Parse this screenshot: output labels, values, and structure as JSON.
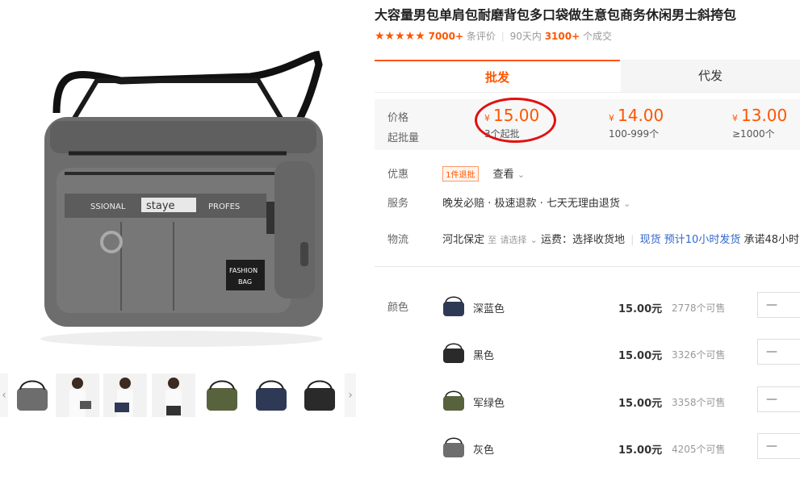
{
  "product": {
    "title": "大容量男包单肩包耐磨背包多口袋做生意包商务休闲男士斜挎包",
    "stars": "★★★★★",
    "review_count": "7000+",
    "review_label": "条评价",
    "days_label": "90天内",
    "sold_count": "3100+",
    "sold_label": "个成交"
  },
  "main_image": {
    "strap_text_left": "SSIONAL",
    "strap_text_mid": "staye",
    "strap_text_right": "PROFES",
    "patch_line1": "FASHION",
    "patch_line2": "BAG"
  },
  "thumbs": [
    "grey-bag-size",
    "model-front",
    "model-back",
    "model-side",
    "green-bag",
    "navy-bag",
    "black-bag"
  ],
  "tabs": {
    "wholesale": "批发",
    "dropship": "代发"
  },
  "pricing": {
    "price_label": "价格",
    "moq_label": "起批量",
    "currency": "¥",
    "tiers": [
      {
        "price": "15.00",
        "qty": "3个起批"
      },
      {
        "price": "14.00",
        "qty": "100-999个"
      },
      {
        "price": "13.00",
        "qty": "≥1000个"
      }
    ]
  },
  "promo": {
    "label": "优惠",
    "badge": "1件退批",
    "view": "查看"
  },
  "service": {
    "label": "服务",
    "text": "晚发必赔 · 极速退款 · 七天无理由退货"
  },
  "logistics": {
    "label": "物流",
    "from": "河北保定",
    "to": "至",
    "select": "请选择",
    "fee": "运费：选择收货地",
    "stock": "现货",
    "ship": "预计10小时发货",
    "promise": "承诺48小时"
  },
  "colors": {
    "label": "颜色",
    "items": [
      {
        "name": "深蓝色",
        "price": "15.00元",
        "stock": "2778个可售",
        "qty": "—",
        "hex": "#2e3a55"
      },
      {
        "name": "黑色",
        "price": "15.00元",
        "stock": "3326个可售",
        "qty": "—",
        "hex": "#2a2a2a"
      },
      {
        "name": "军绿色",
        "price": "15.00元",
        "stock": "3358个可售",
        "qty": "—",
        "hex": "#58633e"
      },
      {
        "name": "灰色",
        "price": "15.00元",
        "stock": "4205个可售",
        "qty": "—",
        "hex": "#6e6e6e"
      }
    ]
  },
  "accent": "#ff5500"
}
